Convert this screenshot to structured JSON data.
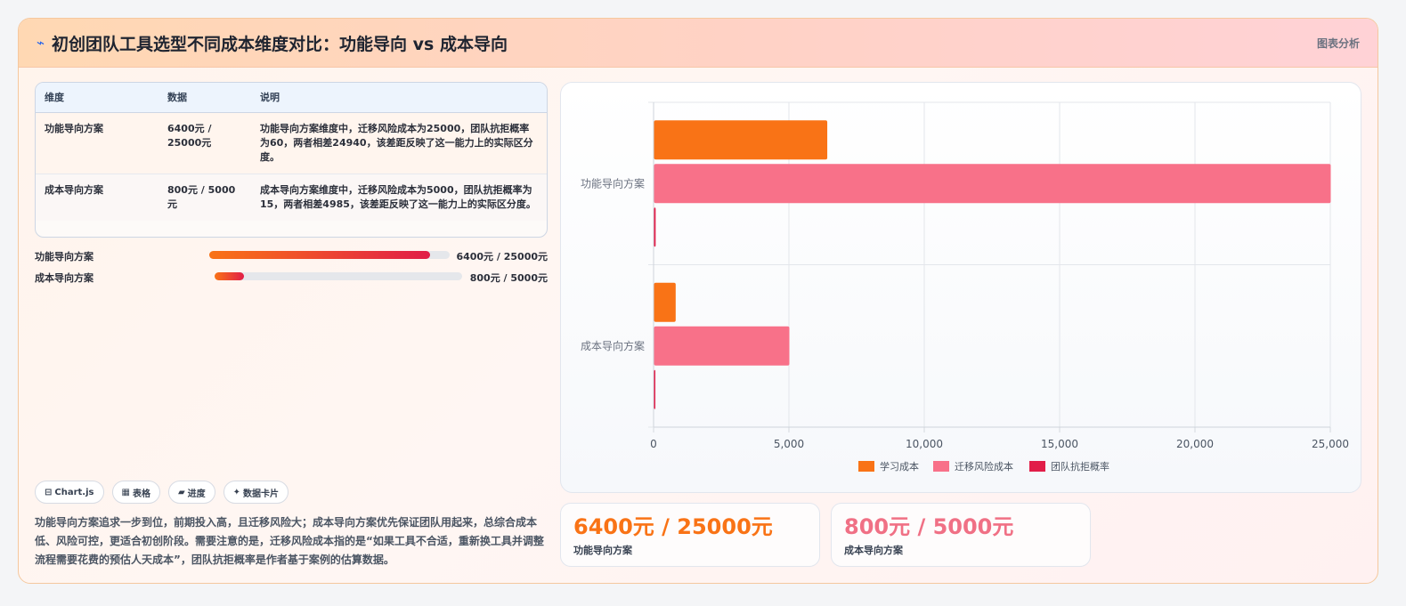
{
  "header": {
    "icon": "⌁",
    "title": "初创团队工具选型不同成本维度对比：功能导向 vs 成本导向",
    "tag": "图表分析"
  },
  "table": {
    "headers": [
      "维度",
      "数据",
      "说明"
    ],
    "rows": [
      {
        "dim": "功能导向方案",
        "data": "6400元 / 25000元",
        "desc": "功能导向方案维度中，迁移风险成本为25000，团队抗拒概率为60，两者相差24940，该差距反映了这一能力上的实际区分度。"
      },
      {
        "dim": "成本导向方案",
        "data": "800元 / 5000元",
        "desc": "成本导向方案维度中，迁移风险成本为5000，团队抗拒概率为15，两者相差4985，该差距反映了这一能力上的实际区分度。"
      }
    ]
  },
  "progress": [
    {
      "label": "功能导向方案",
      "value_text": "6400元 / 25000元",
      "fraction": 0.92
    },
    {
      "label": "成本导向方案",
      "value_text": "800元 / 5000元",
      "fraction": 0.12
    }
  ],
  "tags": [
    {
      "icon": "⊟",
      "label": "Chart.js"
    },
    {
      "icon": "▦",
      "label": "表格"
    },
    {
      "icon": "▰",
      "label": "进度"
    },
    {
      "icon": "✦",
      "label": "数据卡片"
    }
  ],
  "note": "功能导向方案追求一步到位，前期投入高，且迁移风险大；成本导向方案优先保证团队用起来，总综合成本低、风险可控，更适合初创阶段。需要注意的是，迁移风险成本指的是“如果工具不合适，重新换工具并调整流程需要花费的预估人天成本”，团队抗拒概率是作者基于案例的估算数据。",
  "stats": [
    {
      "value": "6400元 / 25000元",
      "label": "功能导向方案",
      "color": "#f97316"
    },
    {
      "value": "800元 / 5000元",
      "label": "成本导向方案",
      "color": "#f07085"
    }
  ],
  "chart_data": {
    "type": "bar",
    "orientation": "horizontal",
    "categories": [
      "功能导向方案",
      "成本导向方案"
    ],
    "series": [
      {
        "name": "学习成本",
        "values": [
          6400,
          800
        ],
        "color": "#f97316"
      },
      {
        "name": "迁移风险成本",
        "values": [
          25000,
          5000
        ],
        "color": "#f87189"
      },
      {
        "name": "团队抗拒概率",
        "values": [
          60,
          15
        ],
        "color": "#e11d48"
      }
    ],
    "xlim": [
      0,
      25000
    ],
    "xticks": [
      0,
      5000,
      10000,
      15000,
      20000,
      25000
    ],
    "xtick_labels": [
      "0",
      "5,000",
      "10,000",
      "15,000",
      "20,000",
      "25,000"
    ],
    "grid": true,
    "legend": "bottom"
  }
}
